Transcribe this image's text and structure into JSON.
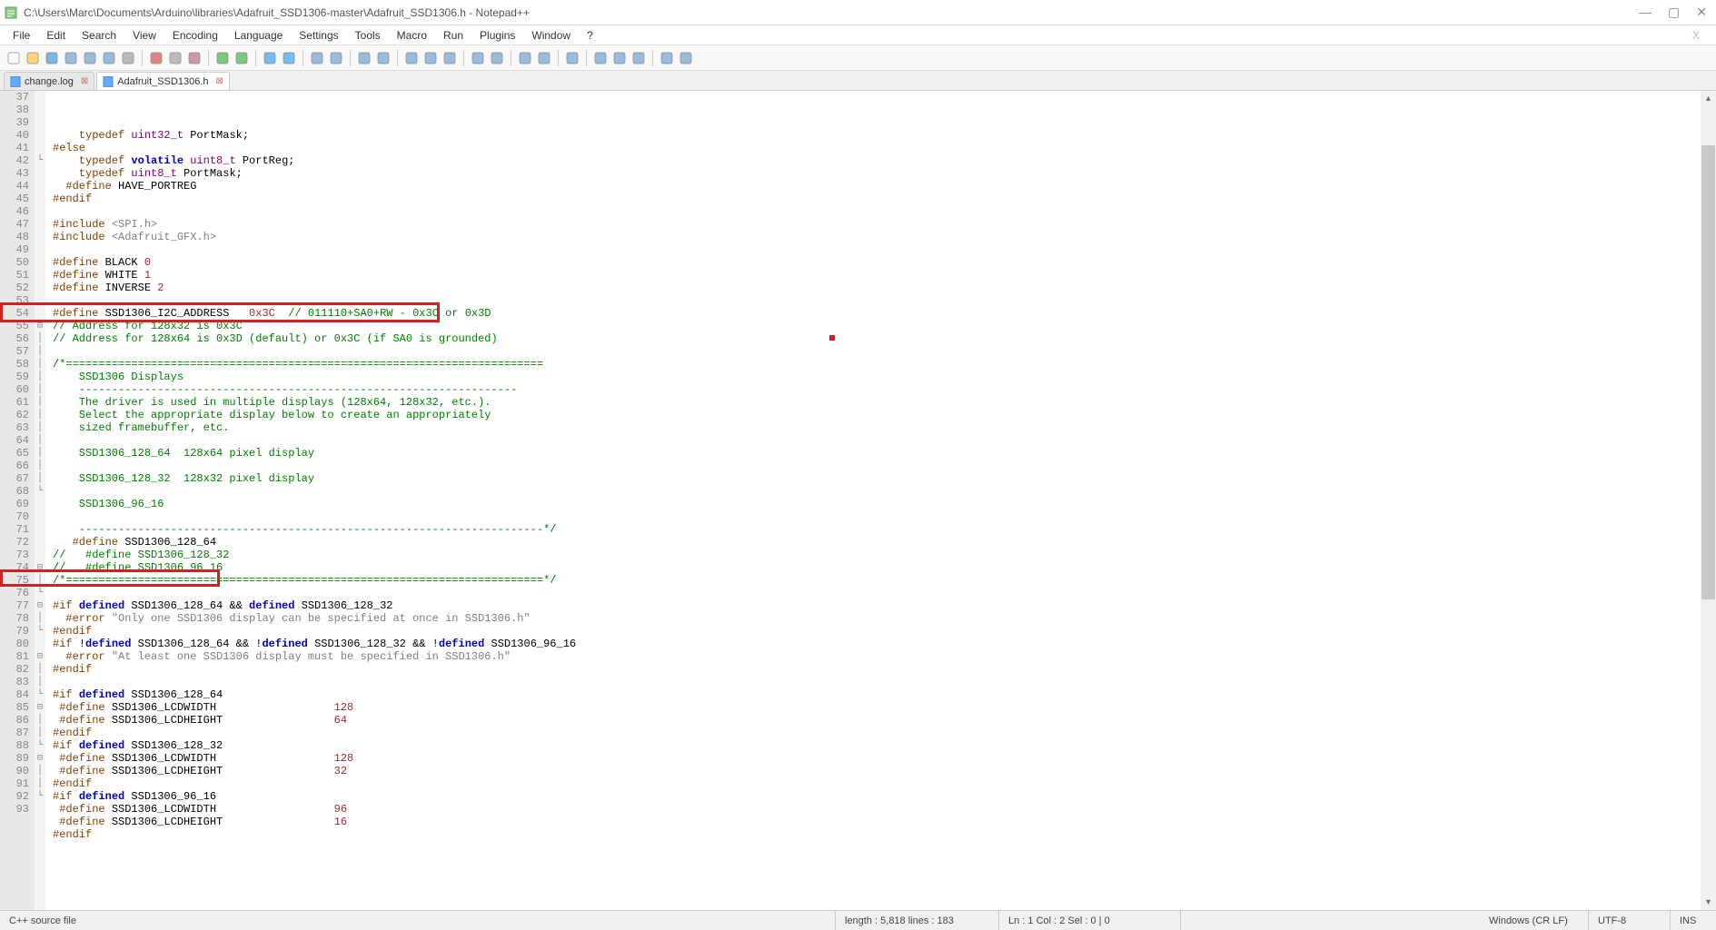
{
  "window": {
    "title": "C:\\Users\\Marc\\Documents\\Arduino\\libraries\\Adafruit_SSD1306-master\\Adafruit_SSD1306.h - Notepad++"
  },
  "menu": {
    "items": [
      "File",
      "Edit",
      "Search",
      "View",
      "Encoding",
      "Language",
      "Settings",
      "Tools",
      "Macro",
      "Run",
      "Plugins",
      "Window",
      "?"
    ]
  },
  "tabs": [
    {
      "label": "change.log",
      "active": false
    },
    {
      "label": "Adafruit_SSD1306.h",
      "active": true
    }
  ],
  "code": {
    "startLine": 37,
    "lines": [
      {
        "n": 37,
        "fold": "",
        "segs": [
          [
            "pre",
            "    typedef "
          ],
          [
            "type",
            "uint32_t"
          ],
          [
            "ident",
            " PortMask;"
          ]
        ]
      },
      {
        "n": 38,
        "fold": "",
        "segs": [
          [
            "pre",
            "#else"
          ]
        ]
      },
      {
        "n": 39,
        "fold": "",
        "segs": [
          [
            "pre",
            "    typedef "
          ],
          [
            "kw",
            "volatile "
          ],
          [
            "type",
            "uint8_t"
          ],
          [
            "ident",
            " PortReg;"
          ]
        ]
      },
      {
        "n": 40,
        "fold": "",
        "segs": [
          [
            "pre",
            "    typedef "
          ],
          [
            "type",
            "uint8_t"
          ],
          [
            "ident",
            " PortMask;"
          ]
        ]
      },
      {
        "n": 41,
        "fold": "",
        "segs": [
          [
            "pre",
            "  #define "
          ],
          [
            "ident",
            "HAVE_PORTREG"
          ]
        ]
      },
      {
        "n": 42,
        "fold": "-",
        "segs": [
          [
            "pre",
            "#endif"
          ]
        ]
      },
      {
        "n": 43,
        "fold": "",
        "segs": [
          [
            "",
            ""
          ]
        ]
      },
      {
        "n": 44,
        "fold": "",
        "segs": [
          [
            "pre",
            "#include "
          ],
          [
            "str",
            "<SPI.h>"
          ]
        ]
      },
      {
        "n": 45,
        "fold": "",
        "segs": [
          [
            "pre",
            "#include "
          ],
          [
            "str",
            "<Adafruit_GFX.h>"
          ]
        ]
      },
      {
        "n": 46,
        "fold": "",
        "segs": [
          [
            "",
            ""
          ]
        ]
      },
      {
        "n": 47,
        "fold": "",
        "segs": [
          [
            "pre",
            "#define "
          ],
          [
            "ident",
            "BLACK "
          ],
          [
            "num",
            "0"
          ]
        ]
      },
      {
        "n": 48,
        "fold": "",
        "segs": [
          [
            "pre",
            "#define "
          ],
          [
            "ident",
            "WHITE "
          ],
          [
            "num",
            "1"
          ]
        ]
      },
      {
        "n": 49,
        "fold": "",
        "segs": [
          [
            "pre",
            "#define "
          ],
          [
            "ident",
            "INVERSE "
          ],
          [
            "num",
            "2"
          ]
        ]
      },
      {
        "n": 50,
        "fold": "",
        "segs": [
          [
            "",
            ""
          ]
        ]
      },
      {
        "n": 51,
        "fold": "",
        "segs": [
          [
            "pre",
            "#define "
          ],
          [
            "ident",
            "SSD1306_I2C_ADDRESS   "
          ],
          [
            "num",
            "0x3C"
          ],
          [
            "cmt",
            "  // 011110+SA0+RW - 0x3C or 0x3D"
          ]
        ]
      },
      {
        "n": 52,
        "fold": "",
        "segs": [
          [
            "cmt",
            "// Address for 128x32 is 0x3C"
          ]
        ]
      },
      {
        "n": 53,
        "fold": "",
        "segs": [
          [
            "cmt",
            "// Address for 128x64 is 0x3D (default) or 0x3C (if SA0 is grounded)"
          ]
        ]
      },
      {
        "n": 54,
        "fold": "",
        "segs": [
          [
            "",
            ""
          ]
        ]
      },
      {
        "n": 55,
        "fold": "⊟",
        "segs": [
          [
            "cmt",
            "/*========================================================================="
          ]
        ]
      },
      {
        "n": 56,
        "fold": "|",
        "segs": [
          [
            "cmt",
            "    SSD1306 Displays"
          ]
        ]
      },
      {
        "n": 57,
        "fold": "|",
        "segs": [
          [
            "cmt",
            "    -------------------------------------------------------------------"
          ]
        ]
      },
      {
        "n": 58,
        "fold": "|",
        "segs": [
          [
            "cmt",
            "    The driver is used in multiple displays (128x64, 128x32, etc.)."
          ]
        ]
      },
      {
        "n": 59,
        "fold": "|",
        "segs": [
          [
            "cmt",
            "    Select the appropriate display below to create an appropriately"
          ]
        ]
      },
      {
        "n": 60,
        "fold": "|",
        "segs": [
          [
            "cmt",
            "    sized framebuffer, etc."
          ]
        ]
      },
      {
        "n": 61,
        "fold": "|",
        "segs": [
          [
            "",
            ""
          ]
        ]
      },
      {
        "n": 62,
        "fold": "|",
        "segs": [
          [
            "cmt",
            "    SSD1306_128_64  128x64 pixel display"
          ]
        ]
      },
      {
        "n": 63,
        "fold": "|",
        "segs": [
          [
            "",
            ""
          ]
        ]
      },
      {
        "n": 64,
        "fold": "|",
        "segs": [
          [
            "cmt",
            "    SSD1306_128_32  128x32 pixel display"
          ]
        ]
      },
      {
        "n": 65,
        "fold": "|",
        "segs": [
          [
            "",
            ""
          ]
        ]
      },
      {
        "n": 66,
        "fold": "|",
        "segs": [
          [
            "cmt",
            "    SSD1306_96_16"
          ]
        ]
      },
      {
        "n": 67,
        "fold": "|",
        "segs": [
          [
            "",
            ""
          ]
        ]
      },
      {
        "n": 68,
        "fold": "-",
        "segs": [
          [
            "cmt",
            "    -----------------------------------------------------------------------*/"
          ]
        ]
      },
      {
        "n": 69,
        "fold": "",
        "segs": [
          [
            "pre",
            "   #define "
          ],
          [
            "ident",
            "SSD1306_128_64"
          ]
        ]
      },
      {
        "n": 70,
        "fold": "",
        "segs": [
          [
            "cmt",
            "//   #define SSD1306_128_32"
          ]
        ]
      },
      {
        "n": 71,
        "fold": "",
        "segs": [
          [
            "cmt",
            "//   #define SSD1306_96_16"
          ]
        ]
      },
      {
        "n": 72,
        "fold": "",
        "segs": [
          [
            "cmt",
            "/*=========================================================================*/"
          ]
        ]
      },
      {
        "n": 73,
        "fold": "",
        "segs": [
          [
            "",
            ""
          ]
        ]
      },
      {
        "n": 74,
        "fold": "⊟",
        "segs": [
          [
            "pre",
            "#if "
          ],
          [
            "kw",
            "defined "
          ],
          [
            "ident",
            "SSD1306_128_64 && "
          ],
          [
            "kw",
            "defined "
          ],
          [
            "ident",
            "SSD1306_128_32"
          ]
        ]
      },
      {
        "n": 75,
        "fold": "|",
        "segs": [
          [
            "pre",
            "  #error "
          ],
          [
            "str",
            "\"Only one SSD1306 display can be specified at once in SSD1306.h\""
          ]
        ]
      },
      {
        "n": 76,
        "fold": "-",
        "segs": [
          [
            "pre",
            "#endif"
          ]
        ]
      },
      {
        "n": 77,
        "fold": "⊟",
        "segs": [
          [
            "pre",
            "#if "
          ],
          [
            "ident",
            "!"
          ],
          [
            "kw",
            "defined "
          ],
          [
            "ident",
            "SSD1306_128_64 && !"
          ],
          [
            "kw",
            "defined "
          ],
          [
            "ident",
            "SSD1306_128_32 && !"
          ],
          [
            "kw",
            "defined "
          ],
          [
            "ident",
            "SSD1306_96_16"
          ]
        ]
      },
      {
        "n": 78,
        "fold": "|",
        "segs": [
          [
            "pre",
            "  #error "
          ],
          [
            "str",
            "\"At least one SSD1306 display must be specified in SSD1306.h\""
          ]
        ]
      },
      {
        "n": 79,
        "fold": "-",
        "segs": [
          [
            "pre",
            "#endif"
          ]
        ]
      },
      {
        "n": 80,
        "fold": "",
        "segs": [
          [
            "",
            ""
          ]
        ]
      },
      {
        "n": 81,
        "fold": "⊟",
        "segs": [
          [
            "pre",
            "#if "
          ],
          [
            "kw",
            "defined "
          ],
          [
            "ident",
            "SSD1306_128_64"
          ]
        ]
      },
      {
        "n": 82,
        "fold": "|",
        "segs": [
          [
            "pre",
            " #define "
          ],
          [
            "ident",
            "SSD1306_LCDWIDTH                  "
          ],
          [
            "num",
            "128"
          ]
        ]
      },
      {
        "n": 83,
        "fold": "|",
        "segs": [
          [
            "pre",
            " #define "
          ],
          [
            "ident",
            "SSD1306_LCDHEIGHT                 "
          ],
          [
            "num",
            "64"
          ]
        ]
      },
      {
        "n": 84,
        "fold": "-",
        "segs": [
          [
            "pre",
            "#endif"
          ]
        ]
      },
      {
        "n": 85,
        "fold": "⊟",
        "segs": [
          [
            "pre",
            "#if "
          ],
          [
            "kw",
            "defined "
          ],
          [
            "ident",
            "SSD1306_128_32"
          ]
        ]
      },
      {
        "n": 86,
        "fold": "|",
        "segs": [
          [
            "pre",
            " #define "
          ],
          [
            "ident",
            "SSD1306_LCDWIDTH                  "
          ],
          [
            "num",
            "128"
          ]
        ]
      },
      {
        "n": 87,
        "fold": "|",
        "segs": [
          [
            "pre",
            " #define "
          ],
          [
            "ident",
            "SSD1306_LCDHEIGHT                 "
          ],
          [
            "num",
            "32"
          ]
        ]
      },
      {
        "n": 88,
        "fold": "-",
        "segs": [
          [
            "pre",
            "#endif"
          ]
        ]
      },
      {
        "n": 89,
        "fold": "⊟",
        "segs": [
          [
            "pre",
            "#if "
          ],
          [
            "kw",
            "defined "
          ],
          [
            "ident",
            "SSD1306_96_16"
          ]
        ]
      },
      {
        "n": 90,
        "fold": "|",
        "segs": [
          [
            "pre",
            " #define "
          ],
          [
            "ident",
            "SSD1306_LCDWIDTH                  "
          ],
          [
            "num",
            "96"
          ]
        ]
      },
      {
        "n": 91,
        "fold": "|",
        "segs": [
          [
            "pre",
            " #define "
          ],
          [
            "ident",
            "SSD1306_LCDHEIGHT                 "
          ],
          [
            "num",
            "16"
          ]
        ]
      },
      {
        "n": 92,
        "fold": "-",
        "segs": [
          [
            "pre",
            "#endif"
          ]
        ]
      },
      {
        "n": 93,
        "fold": "",
        "segs": [
          [
            "",
            ""
          ]
        ]
      }
    ]
  },
  "status": {
    "filetype": "C++ source file",
    "length": "length : 5,818    lines : 183",
    "pos": "Ln : 1    Col : 2    Sel : 0 | 0",
    "eol": "Windows (CR LF)",
    "encoding": "UTF-8",
    "mode": "INS"
  },
  "toolbarIcons": [
    "new",
    "open",
    "save",
    "save-all",
    "close",
    "close-all",
    "print",
    "sep",
    "cut",
    "copy",
    "paste",
    "sep",
    "undo",
    "redo",
    "sep",
    "find",
    "replace",
    "sep",
    "zoom-in",
    "zoom-out",
    "sep",
    "sync-v",
    "sync-h",
    "sep",
    "wrap",
    "all-chars",
    "indent",
    "sep",
    "fold",
    "unfold",
    "sep",
    "doc-map",
    "func-list",
    "sep",
    "monitor",
    "sep",
    "record",
    "stop",
    "play",
    "sep",
    "play-multi",
    "save-macro"
  ]
}
